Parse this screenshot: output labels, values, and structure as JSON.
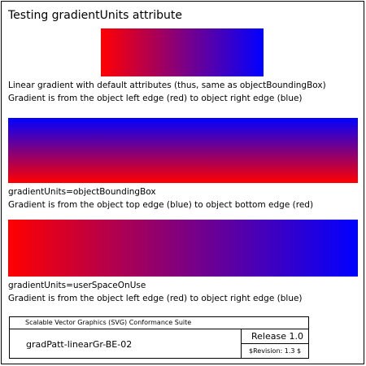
{
  "title": "Testing gradientUnits attribute",
  "colors": {
    "red": "#ff0000",
    "blue": "#0000ff"
  },
  "tests": [
    {
      "direction": "left-to-right",
      "caption_1": "Linear gradient with default attributes (thus, same as objectBoundingBox)",
      "caption_2": "Gradient is from the object left edge (red) to object right edge (blue)"
    },
    {
      "direction": "bottom-to-top",
      "caption_1": "gradientUnits=objectBoundingBox",
      "caption_2": "Gradient is from the object top edge (blue) to object bottom edge (red)"
    },
    {
      "direction": "left-to-right",
      "caption_1": "gradientUnits=userSpaceOnUse",
      "caption_2": "Gradient is from the object left edge (red) to object right edge (blue)"
    }
  ],
  "footer": {
    "suite_name": "Scalable Vector Graphics (SVG) Conformance Suite",
    "test_name": "gradPatt-linearGr-BE-02",
    "release": "Release 1.0",
    "revision": "$Revision: 1.3 $"
  }
}
